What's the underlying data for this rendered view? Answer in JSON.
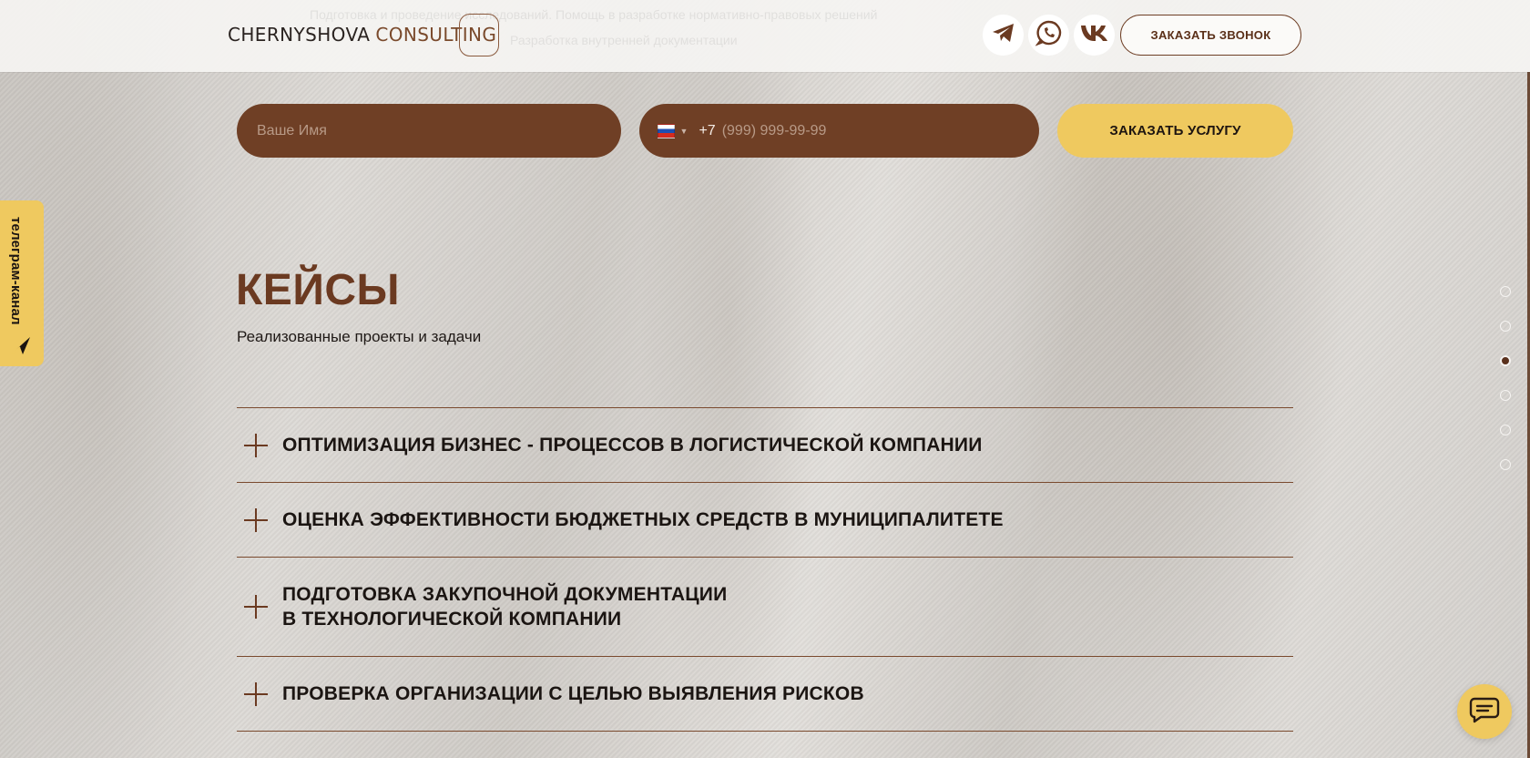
{
  "header": {
    "logo_dark": "CHERNYSHOVA",
    "logo_brown": "CONSULTING",
    "ghost_line_1": "Подготовка и проведение исследований. Помощь в разработке нормативно-правовых решений",
    "ghost_line_2": "Разработка внутренней документации",
    "call_label": "ЗАКАЗАТЬ ЗВОНОК",
    "social_icons": [
      "telegram-icon",
      "whatsapp-icon",
      "vk-icon"
    ]
  },
  "form": {
    "name_placeholder": "Ваше Имя",
    "phone_prefix": "+7",
    "phone_placeholder": "(999) 999-99-99",
    "order_label": "ЗАКАЗАТЬ УСЛУГУ"
  },
  "telegram_tab": {
    "label": "телеграм-канал"
  },
  "cases": {
    "title": "КЕЙСЫ",
    "subtitle": "Реализованные проекты и задачи",
    "items": [
      {
        "line1": "ОПТИМИЗАЦИЯ БИЗНЕС - ПРОЦЕССОВ В ЛОГИСТИЧЕСКОЙ КОМПАНИИ",
        "line2": ""
      },
      {
        "line1": "ОЦЕНКА ЭФФЕКТИВНОСТИ БЮДЖЕТНЫХ СРЕДСТВ В МУНИЦИПАЛИТЕТЕ",
        "line2": ""
      },
      {
        "line1": "ПОДГОТОВКА ЗАКУПОЧНОЙ ДОКУМЕНТАЦИИ",
        "line2": "В ТЕХНОЛОГИЧЕСКОЙ КОМПАНИИ"
      },
      {
        "line1": "ПРОВЕРКА ОРГАНИЗАЦИИ С ЦЕЛЬЮ ВЫЯВЛЕНИЯ РИСКОВ",
        "line2": ""
      }
    ]
  },
  "section_nav": {
    "count": 6,
    "active_index": 2
  },
  "colors": {
    "brand_brown": "#6f3f25",
    "accent_yellow": "#efc95f",
    "title_brown": "#6b3a21"
  }
}
